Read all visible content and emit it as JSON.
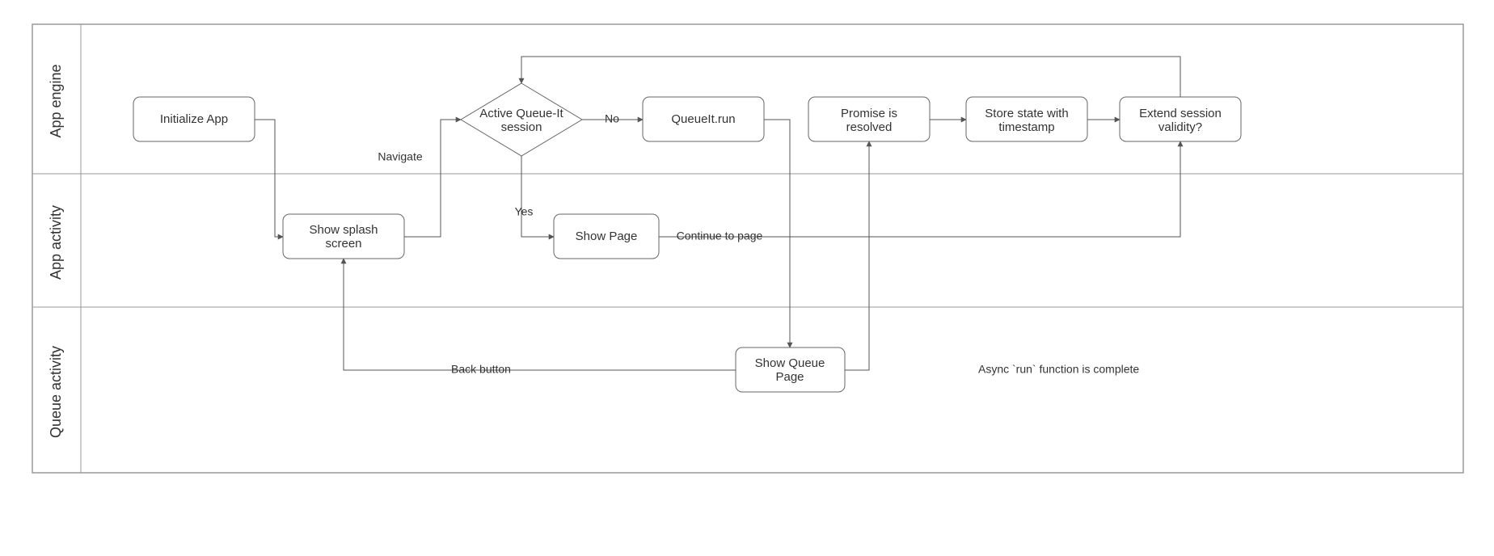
{
  "lanes": {
    "lane1": "App engine",
    "lane2": "App activity",
    "lane3": "Queue activity"
  },
  "nodes": {
    "init": "Initialize App",
    "decision1": "Active Queue-It",
    "decision2": "session",
    "run": "QueueIt.run",
    "promise": "Promise is",
    "promise2": "resolved",
    "store1": "Store state with",
    "store2": "timestamp",
    "extend1": "Extend session",
    "extend2": "validity?",
    "splash1": "Show splash",
    "splash2": "screen",
    "showpage": "Show Page",
    "queuepage1": "Show Queue",
    "queuepage2": "Page"
  },
  "edges": {
    "navigate": "Navigate",
    "no": "No",
    "yes": "Yes",
    "continue": "Continue to page",
    "back": "Back button",
    "async": "Async `run` function is complete"
  }
}
